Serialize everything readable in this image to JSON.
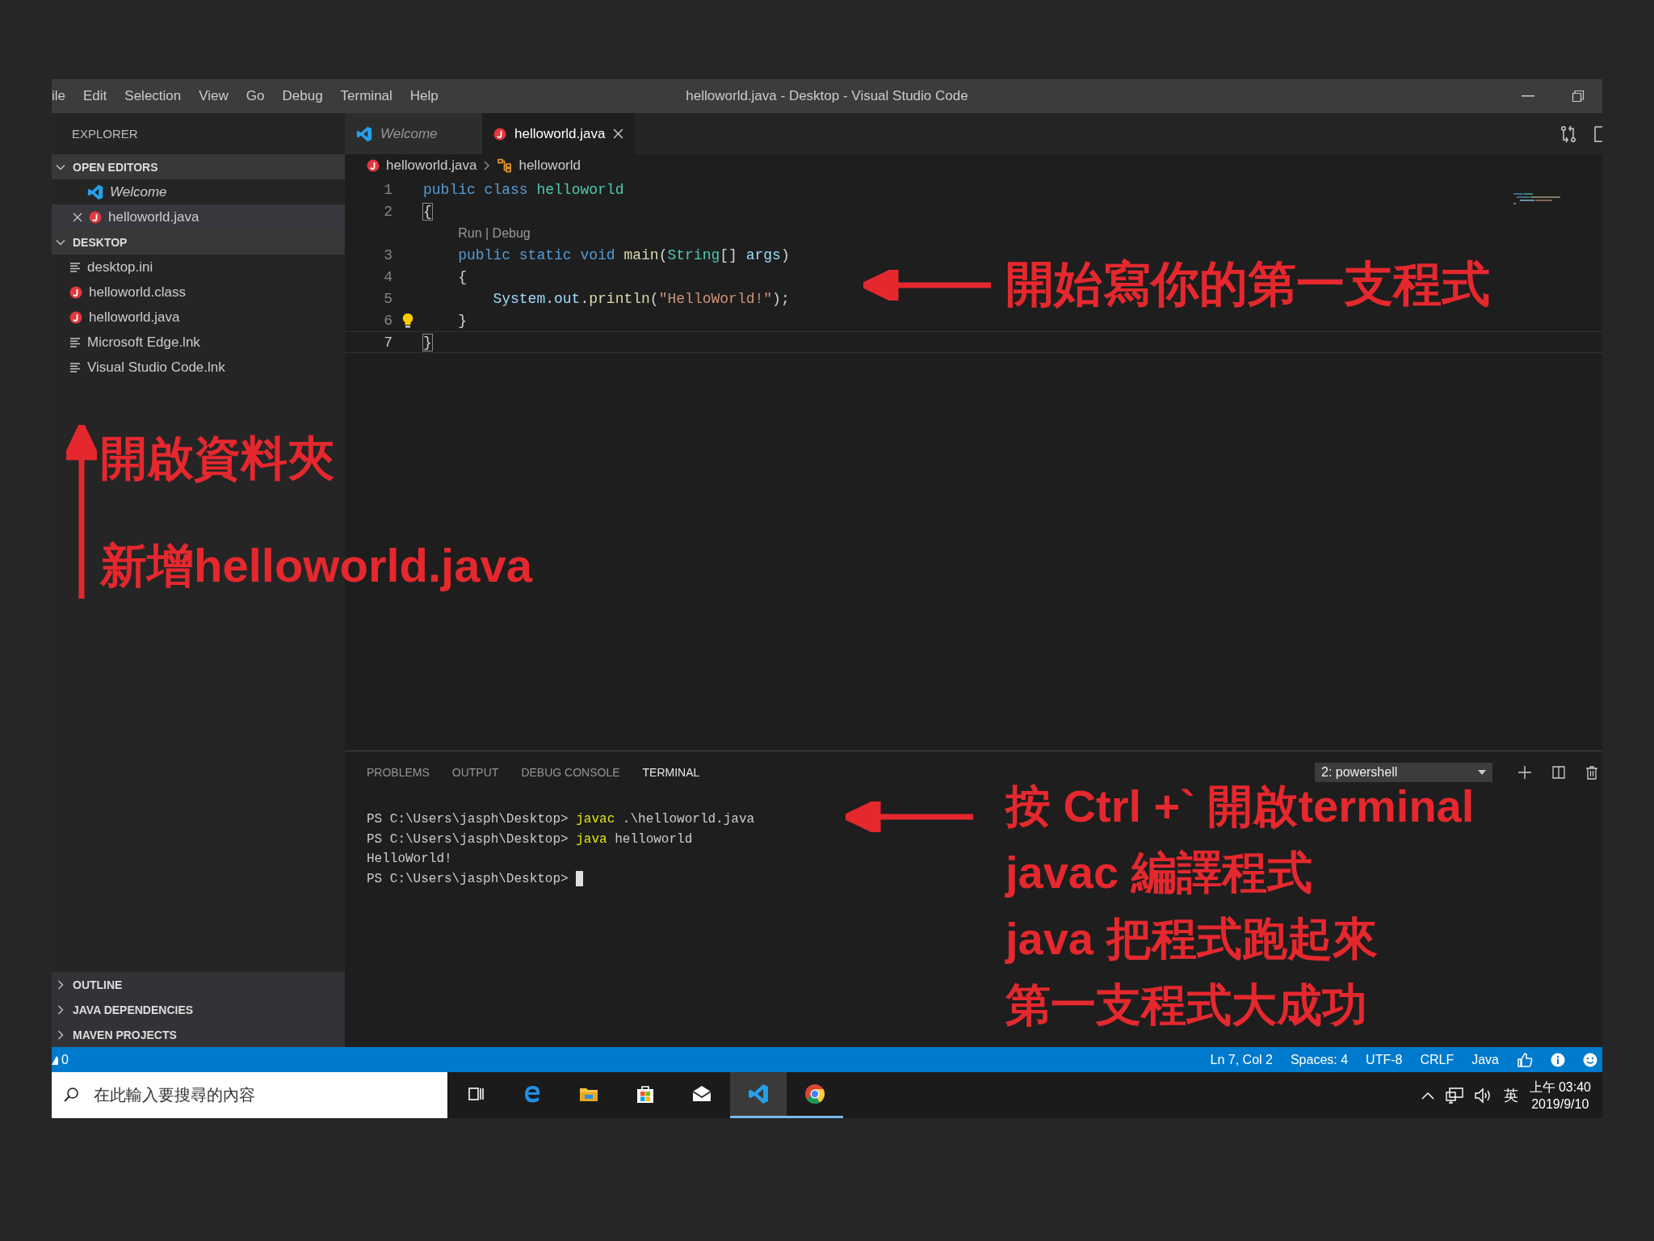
{
  "window": {
    "title": "helloworld.java - Desktop - Visual Studio Code"
  },
  "menu": [
    "ile",
    "Edit",
    "Selection",
    "View",
    "Go",
    "Debug",
    "Terminal",
    "Help"
  ],
  "explorer": {
    "title": "EXPLORER",
    "open_editors": {
      "title": "OPEN EDITORS",
      "expanded": true,
      "items": [
        {
          "label": "Welcome",
          "kind": "vscode",
          "preview": true,
          "selected": false
        },
        {
          "label": "helloworld.java",
          "kind": "java",
          "preview": false,
          "selected": true
        }
      ]
    },
    "folder": {
      "title": "DESKTOP",
      "expanded": true,
      "items": [
        {
          "label": "desktop.ini",
          "kind": "file"
        },
        {
          "label": "helloworld.class",
          "kind": "java"
        },
        {
          "label": "helloworld.java",
          "kind": "java"
        },
        {
          "label": "Microsoft Edge.lnk",
          "kind": "file"
        },
        {
          "label": "Visual Studio Code.lnk",
          "kind": "file"
        }
      ]
    },
    "collapsed_sections": [
      {
        "title": "OUTLINE",
        "expanded": false
      },
      {
        "title": "JAVA DEPENDENCIES",
        "expanded": false
      },
      {
        "title": "MAVEN PROJECTS",
        "expanded": false
      }
    ]
  },
  "tabs": [
    {
      "label": "Welcome",
      "kind": "vscode",
      "preview": true,
      "selected": false
    },
    {
      "label": "helloworld.java",
      "kind": "java",
      "preview": false,
      "selected": true
    }
  ],
  "breadcrumbs": [
    {
      "label": "helloworld.java",
      "kind": "java"
    },
    {
      "label": "helloworld",
      "kind": "class"
    }
  ],
  "code": [
    {
      "kind": "code",
      "number": "1",
      "current": false,
      "hint": false,
      "tokens": [
        {
          "text": "public class ",
          "kind": "keyword"
        },
        {
          "text": "helloworld",
          "kind": "type"
        }
      ]
    },
    {
      "kind": "code",
      "number": "2",
      "current": false,
      "hint": false,
      "tokens": [
        {
          "text": "{",
          "kind": "bracket"
        }
      ],
      "children": [
        {
          "kind": "codelens",
          "text": "Run | Debug"
        },
        {
          "kind": "code",
          "number": "3",
          "current": false,
          "hint": false,
          "tokens": [
            {
              "text": "public static void ",
              "kind": "keyword"
            },
            {
              "text": "main",
              "kind": "function"
            },
            {
              "text": "(",
              "kind": "plain"
            },
            {
              "text": "String",
              "kind": "type"
            },
            {
              "text": "[] ",
              "kind": "plain"
            },
            {
              "text": "args",
              "kind": "variable"
            },
            {
              "text": ")",
              "kind": "plain"
            }
          ]
        },
        {
          "kind": "code",
          "number": "4",
          "current": false,
          "hint": false,
          "tokens": [
            {
              "text": "{",
              "kind": "plain"
            }
          ],
          "children": [
            {
              "kind": "code",
              "number": "5",
              "current": false,
              "hint": false,
              "tokens": [
                {
                  "text": "System",
                  "kind": "variable"
                },
                {
                  "text": ".",
                  "kind": "plain"
                },
                {
                  "text": "out",
                  "kind": "variable"
                },
                {
                  "text": ".",
                  "kind": "plain"
                },
                {
                  "text": "println",
                  "kind": "function"
                },
                {
                  "text": "(",
                  "kind": "plain"
                },
                {
                  "text": "\"HelloWorld!\"",
                  "kind": "string"
                },
                {
                  "text": ");",
                  "kind": "plain"
                }
              ]
            }
          ]
        },
        {
          "kind": "code",
          "number": "6",
          "current": false,
          "hint": true,
          "tokens": [
            {
              "text": "}",
              "kind": "plain"
            }
          ]
        }
      ]
    },
    {
      "kind": "code",
      "number": "7",
      "current": true,
      "hint": false,
      "tokens": [
        {
          "text": "}",
          "kind": "bracket"
        }
      ]
    }
  ],
  "panel": {
    "tabs": [
      {
        "label": "PROBLEMS",
        "selected": false
      },
      {
        "label": "OUTPUT",
        "selected": false
      },
      {
        "label": "DEBUG CONSOLE",
        "selected": false
      },
      {
        "label": "TERMINAL",
        "selected": true
      }
    ],
    "terminal_select": "2: powershell",
    "lines": [
      {
        "cursor": false,
        "tokens": [
          {
            "text": "PS C:\\Users\\jasph\\Desktop> ",
            "kind": "plain"
          },
          {
            "text": "javac",
            "kind": "command"
          },
          {
            "text": " .\\helloworld.java",
            "kind": "plain"
          }
        ]
      },
      {
        "cursor": false,
        "tokens": [
          {
            "text": "PS C:\\Users\\jasph\\Desktop> ",
            "kind": "plain"
          },
          {
            "text": "java",
            "kind": "command"
          },
          {
            "text": " helloworld",
            "kind": "plain"
          }
        ]
      },
      {
        "cursor": false,
        "tokens": [
          {
            "text": "HelloWorld!",
            "kind": "plain"
          }
        ]
      },
      {
        "cursor": true,
        "tokens": [
          {
            "text": "PS C:\\Users\\jasph\\Desktop> ",
            "kind": "plain"
          }
        ]
      }
    ]
  },
  "status_bar": {
    "problems": "0",
    "items": [
      "Ln 7, Col 2",
      "Spaces: 4",
      "UTF-8",
      "CRLF",
      "Java"
    ]
  },
  "taskbar": {
    "search_placeholder": "在此輸入要搜尋的內容",
    "apps": [
      {
        "kind": "taskview",
        "selected": false,
        "running": false
      },
      {
        "kind": "edge",
        "selected": false,
        "running": false
      },
      {
        "kind": "files",
        "selected": false,
        "running": false
      },
      {
        "kind": "store",
        "selected": false,
        "running": false
      },
      {
        "kind": "mail",
        "selected": false,
        "running": false
      },
      {
        "kind": "vscode",
        "selected": true,
        "running": true
      },
      {
        "kind": "chrome",
        "selected": false,
        "running": true
      }
    ],
    "language": "英",
    "time": "上午 03:40",
    "date": "2019/9/10"
  },
  "annotations": {
    "editor": "開始寫你的第一支程式",
    "sidebar": [
      "開啟資料夾",
      "新增helloworld.java"
    ],
    "terminal": [
      "按 Ctrl +` 開啟terminal",
      "javac 編譯程式",
      "java 把程式跑起來",
      "第一支程式大成功"
    ]
  }
}
